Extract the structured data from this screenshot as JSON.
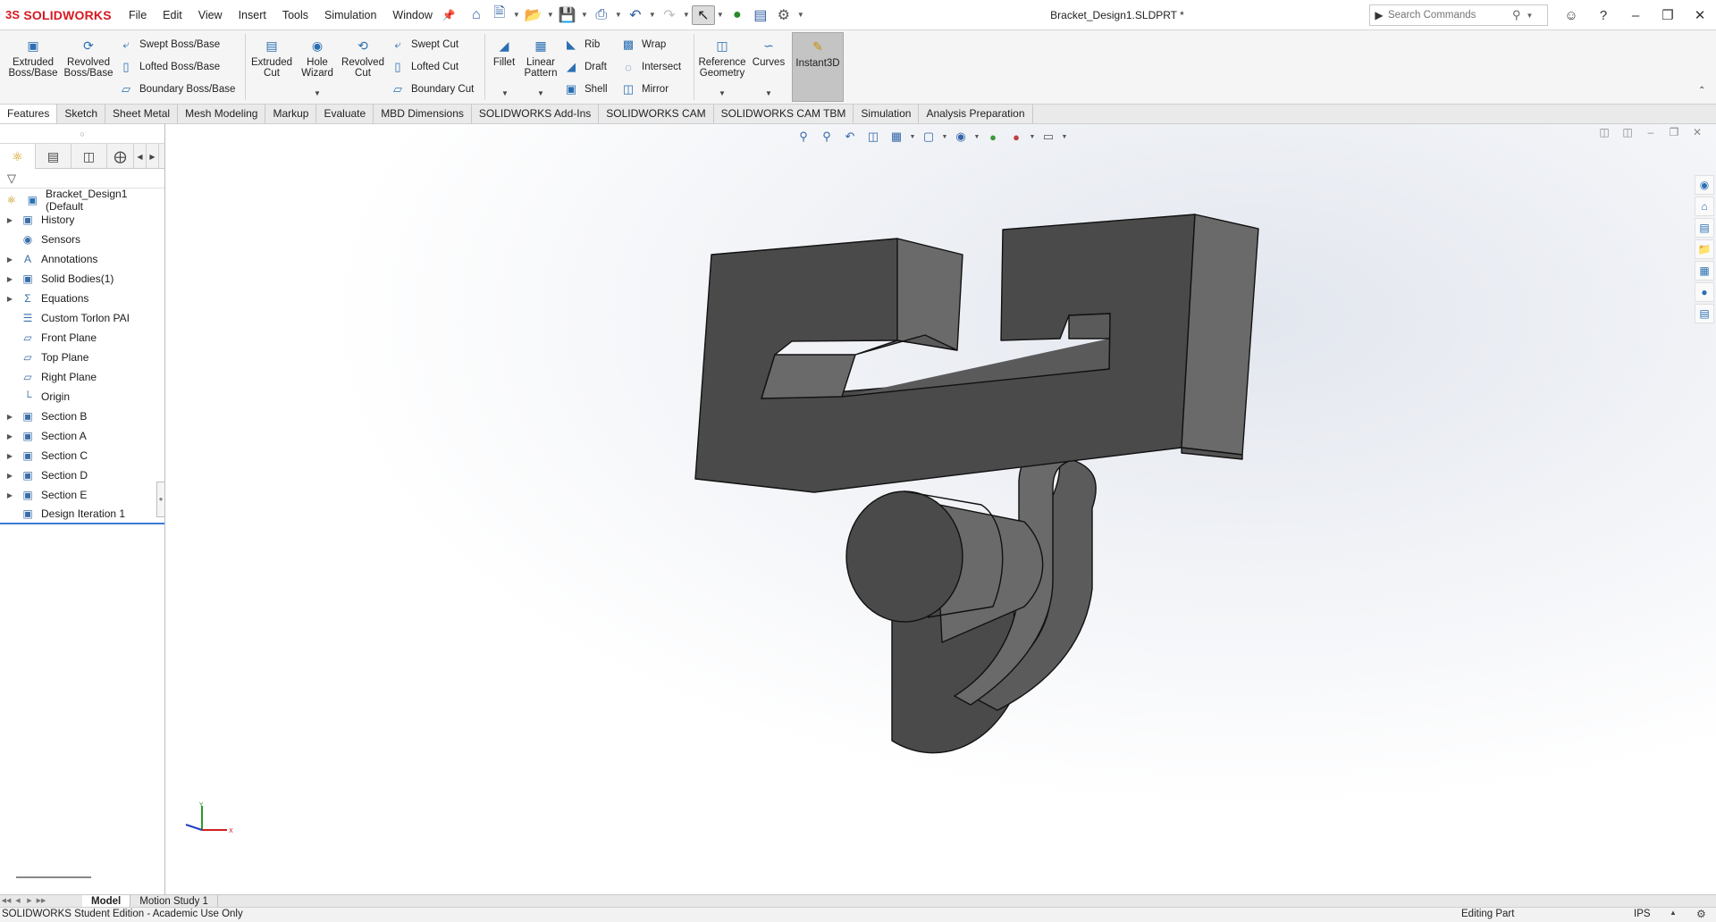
{
  "app": {
    "brand": "SOLIDWORKS",
    "brand_prefix": "3S",
    "document_title": "Bracket_Design1.SLDPRT *"
  },
  "menu": [
    "File",
    "Edit",
    "View",
    "Insert",
    "Tools",
    "Simulation",
    "Window"
  ],
  "quick_access_icons": [
    "home-icon",
    "new-document-icon",
    "open-icon",
    "save-icon",
    "print-icon",
    "undo-icon",
    "redo-icon",
    "select-icon",
    "rebuild-icon",
    "file-properties-icon",
    "options-icon"
  ],
  "search": {
    "placeholder": "Search Commands"
  },
  "command_manager": {
    "extruded_boss": "Extruded\nBoss/Base",
    "revolved_boss": "Revolved\nBoss/Base",
    "swept_boss": "Swept Boss/Base",
    "lofted_boss": "Lofted Boss/Base",
    "boundary_boss": "Boundary Boss/Base",
    "extruded_cut": "Extruded\nCut",
    "hole_wizard": "Hole\nWizard",
    "revolved_cut": "Revolved\nCut",
    "swept_cut": "Swept Cut",
    "lofted_cut": "Lofted Cut",
    "boundary_cut": "Boundary Cut",
    "fillet": "Fillet",
    "linear_pattern": "Linear\nPattern",
    "rib": "Rib",
    "draft": "Draft",
    "shell": "Shell",
    "wrap": "Wrap",
    "intersect": "Intersect",
    "mirror": "Mirror",
    "reference_geometry": "Reference\nGeometry",
    "curves": "Curves",
    "instant3d": "Instant3D"
  },
  "tabs": [
    "Features",
    "Sketch",
    "Sheet Metal",
    "Mesh Modeling",
    "Markup",
    "Evaluate",
    "MBD Dimensions",
    "SOLIDWORKS Add-Ins",
    "SOLIDWORKS CAM",
    "SOLIDWORKS CAM TBM",
    "Simulation",
    "Analysis Preparation"
  ],
  "active_tab": "Features",
  "feature_tree": {
    "root": "Bracket_Design1  (Default",
    "items": [
      {
        "label": "History",
        "expandable": true,
        "icon": "history-folder-icon"
      },
      {
        "label": "Sensors",
        "expandable": false,
        "icon": "sensors-folder-icon"
      },
      {
        "label": "Annotations",
        "expandable": true,
        "icon": "annotations-icon"
      },
      {
        "label": "Solid Bodies(1)",
        "expandable": true,
        "icon": "solid-bodies-icon"
      },
      {
        "label": "Equations",
        "expandable": true,
        "icon": "equations-icon"
      },
      {
        "label": "Custom Torlon PAI",
        "expandable": false,
        "icon": "material-icon"
      },
      {
        "label": "Front Plane",
        "expandable": false,
        "icon": "plane-icon"
      },
      {
        "label": "Top Plane",
        "expandable": false,
        "icon": "plane-icon"
      },
      {
        "label": "Right Plane",
        "expandable": false,
        "icon": "plane-icon"
      },
      {
        "label": "Origin",
        "expandable": false,
        "icon": "origin-icon"
      },
      {
        "label": "Section B",
        "expandable": true,
        "icon": "feature-icon"
      },
      {
        "label": "Section A",
        "expandable": true,
        "icon": "feature-icon"
      },
      {
        "label": "Section C",
        "expandable": true,
        "icon": "feature-icon"
      },
      {
        "label": "Section D",
        "expandable": true,
        "icon": "feature-icon"
      },
      {
        "label": "Section E",
        "expandable": true,
        "icon": "feature-icon"
      },
      {
        "label": "Design Iteration 1",
        "expandable": false,
        "icon": "design-iteration-icon"
      }
    ]
  },
  "triad": {
    "x": "X",
    "y": "Y"
  },
  "bottom_tabs": [
    "Model",
    "Motion Study 1"
  ],
  "active_bottom_tab": "Model",
  "status": {
    "left": "SOLIDWORKS Student Edition - Academic Use Only",
    "mode": "Editing Part",
    "units": "IPS"
  },
  "colors": {
    "brand": "#d71920",
    "model_face_dark": "#4a4a4a",
    "model_face_light": "#6a6a6a",
    "instant3d_active": "#c4c4c4"
  }
}
